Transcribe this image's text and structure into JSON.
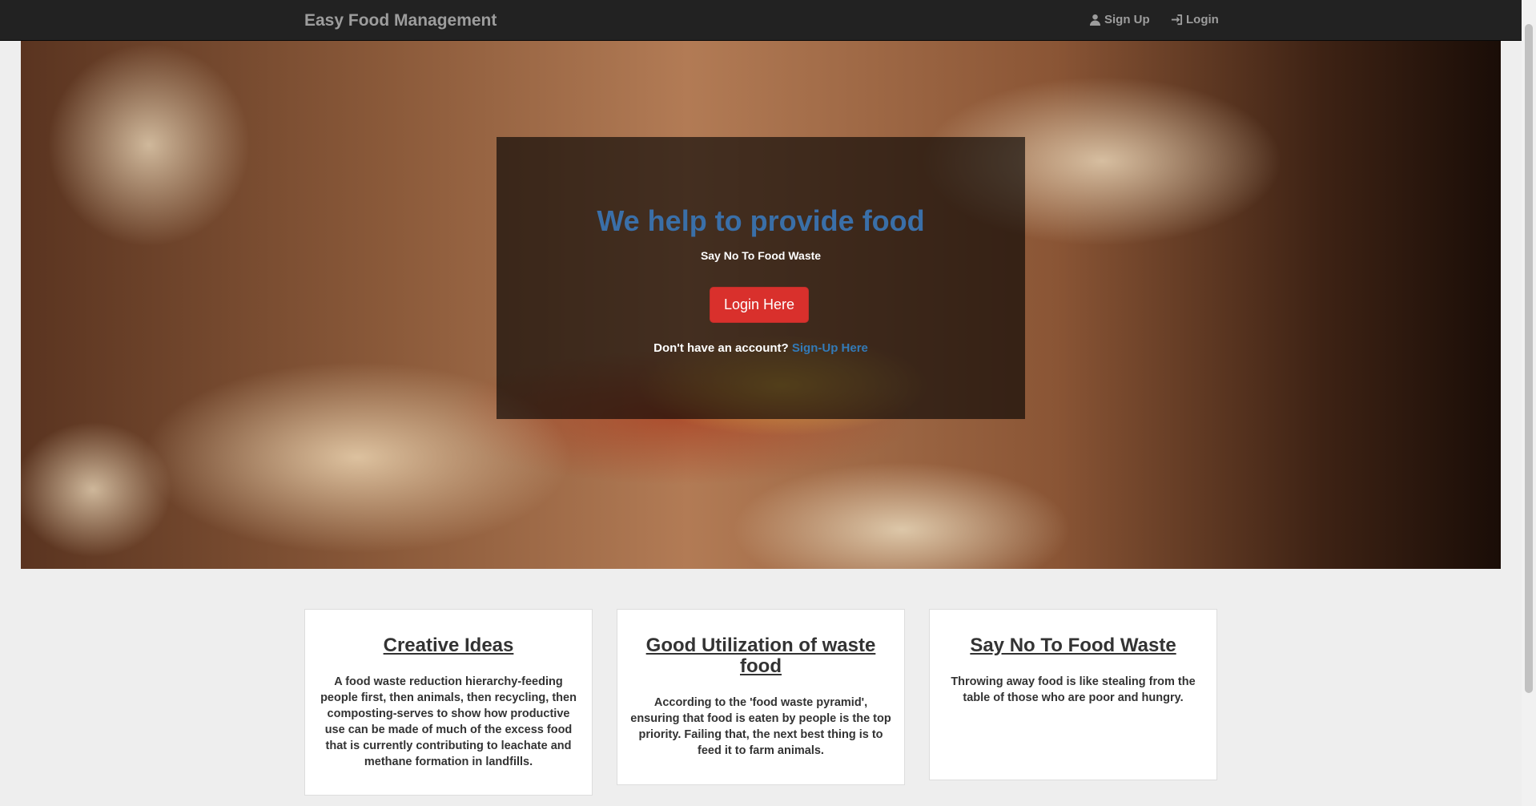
{
  "navbar": {
    "brand": "Easy Food Management",
    "signup_label": "Sign Up",
    "login_label": "Login"
  },
  "hero": {
    "title": "We help to provide food",
    "subtitle": "Say No To Food Waste",
    "login_button": "Login Here",
    "no_account_text": "Don't have an account?",
    "signup_link": "Sign-Up Here"
  },
  "cards": [
    {
      "title": "Creative Ideas",
      "text": "A food waste reduction hierarchy-feeding people first, then animals, then recycling, then composting-serves to show how productive use can be made of much of the excess food that is currently contributing to leachate and methane formation in landfills."
    },
    {
      "title": "Good Utilization of waste food",
      "text": "According to the 'food waste pyramid', ensuring that food is eaten by people is the top priority. Failing that, the next best thing is to feed it to farm animals."
    },
    {
      "title": "Say No To Food Waste",
      "text": "Throwing away food is like stealing from the table of those who are poor and hungry."
    }
  ],
  "colors": {
    "navbar_bg": "#222222",
    "accent_link": "#337ab7",
    "login_button": "#d9302c",
    "page_bg": "#eeeeee"
  }
}
